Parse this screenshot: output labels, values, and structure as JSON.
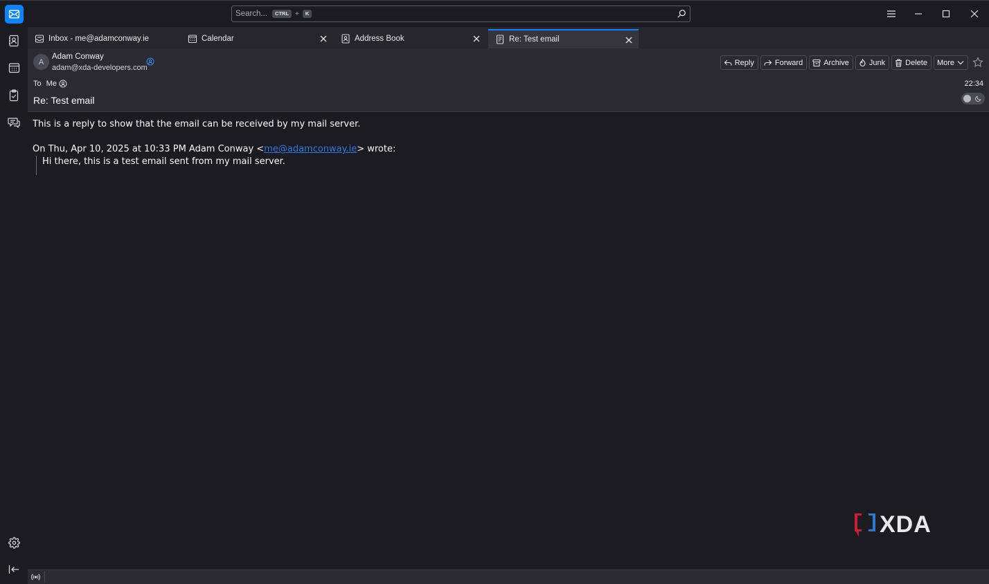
{
  "search": {
    "placeholder": "Search...",
    "shortcut_modifier": "CTRL",
    "shortcut_plus": "+",
    "shortcut_key": "K"
  },
  "tabs": [
    {
      "label": "Inbox - me@adamconway.ie",
      "icon": "inbox-icon",
      "active": false
    },
    {
      "label": "Calendar",
      "icon": "calendar-icon",
      "active": false
    },
    {
      "label": "Address Book",
      "icon": "address-book-icon",
      "active": false
    },
    {
      "label": "Re: Test email",
      "icon": "message-icon",
      "active": true
    }
  ],
  "message": {
    "avatar_initial": "A",
    "from_name": "Adam Conway",
    "from_email": "adam@xda-developers.com",
    "to_label": "To",
    "to_value": "Me",
    "time": "22:34",
    "subject": "Re: Test email",
    "actions": {
      "reply": "Reply",
      "forward": "Forward",
      "archive": "Archive",
      "junk": "Junk",
      "delete": "Delete",
      "more": "More"
    },
    "body_line": "This is a reply to show that the email can be received by my mail server.",
    "quote_prefix": "On Thu, Apr 10, 2025 at 10:33 PM Adam Conway <",
    "quote_link": "me@adamconway.ie",
    "quote_suffix": "> wrote:",
    "quoted_text": "Hi there, this is a test email sent from my mail server."
  },
  "watermark": "XDA",
  "colors": {
    "accent": "#0a84ff",
    "link": "#2a7ae2",
    "background": "#1c1b22",
    "header_bg": "#2b2a33"
  }
}
